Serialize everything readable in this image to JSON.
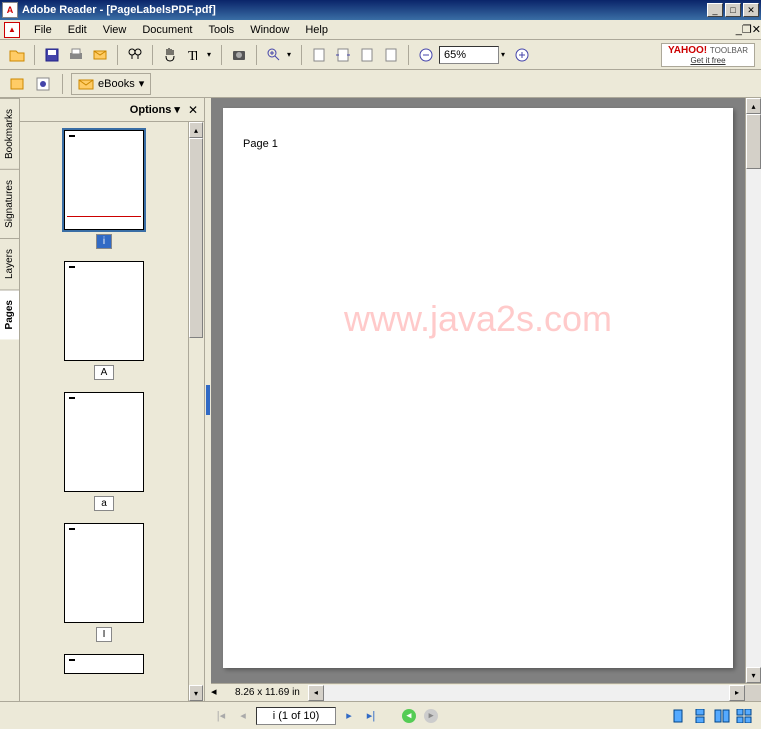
{
  "titlebar": {
    "app": "Adobe Reader",
    "doc": "[PageLabelsPDF.pdf]"
  },
  "menu": {
    "file": "File",
    "edit": "Edit",
    "view": "View",
    "document": "Document",
    "tools": "Tools",
    "window": "Window",
    "help": "Help"
  },
  "toolbar": {
    "zoom": "65%"
  },
  "toolbar2": {
    "ebooks": "eBooks"
  },
  "yahoo": {
    "brand": "YAHOO!",
    "sub": "TOOLBAR",
    "cta": "Get it free"
  },
  "sidetabs": {
    "bookmarks": "Bookmarks",
    "signatures": "Signatures",
    "layers": "Layers",
    "pages": "Pages"
  },
  "pagespanel": {
    "options": "Options",
    "thumbs": [
      {
        "label": "i",
        "selected": true
      },
      {
        "label": "A",
        "selected": false
      },
      {
        "label": "a",
        "selected": false
      },
      {
        "label": "I",
        "selected": false
      }
    ]
  },
  "page": {
    "content": "Page 1"
  },
  "watermark": "www.java2s.com",
  "statusbar": {
    "dim": "8.26 x 11.69 in",
    "pageinfo": "i  (1 of 10)"
  }
}
